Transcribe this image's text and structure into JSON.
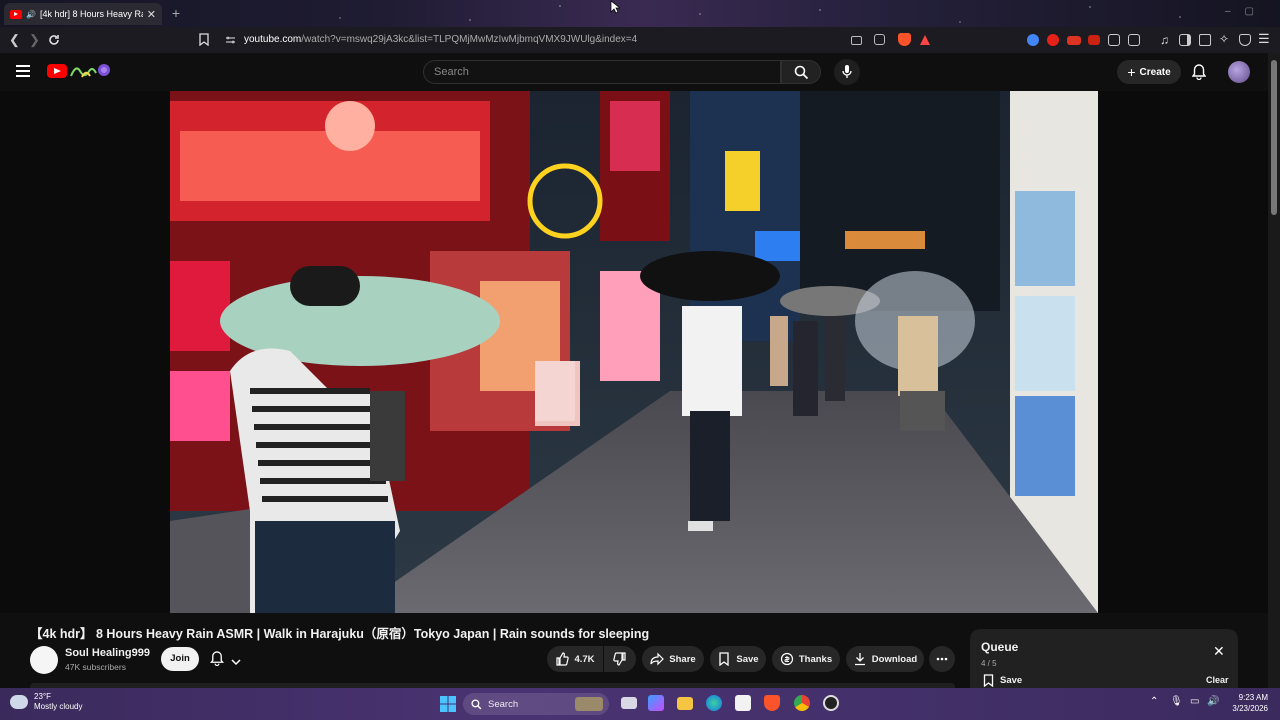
{
  "browser": {
    "tab_title": "[4k hdr] 8 Hours Heavy Rain",
    "new_tab": "+",
    "url_host": "youtube.com",
    "url_path": "/watch?v=mswq29jA3kc&list=TLPQMjMwMzIwMjbmqVMX9JWUlg&index=4"
  },
  "youtube": {
    "search_placeholder": "Search",
    "create_label": "Create",
    "video": {
      "title": "【4k hdr】 8 Hours Heavy Rain ASMR | Walk in Harajuku（原宿）Tokyo Japan | Rain sounds for sleeping",
      "channel_name": "Soul Healing999",
      "subscribers": "47K subscribers",
      "join_label": "Join",
      "likes": "4.7K",
      "share_label": "Share",
      "save_label": "Save",
      "thanks_label": "Thanks",
      "download_label": "Download"
    },
    "queue": {
      "title": "Queue",
      "position": "4 / 5",
      "save_label": "Save",
      "clear_label": "Clear"
    }
  },
  "taskbar": {
    "temperature": "23°F",
    "condition": "Mostly cloudy",
    "search_label": "Search",
    "time": "9:23 AM",
    "date": "3/23/2026"
  },
  "colors": {
    "youtube_red": "#ff0000",
    "background": "#0f0f0f",
    "taskbar": "#43306a"
  }
}
